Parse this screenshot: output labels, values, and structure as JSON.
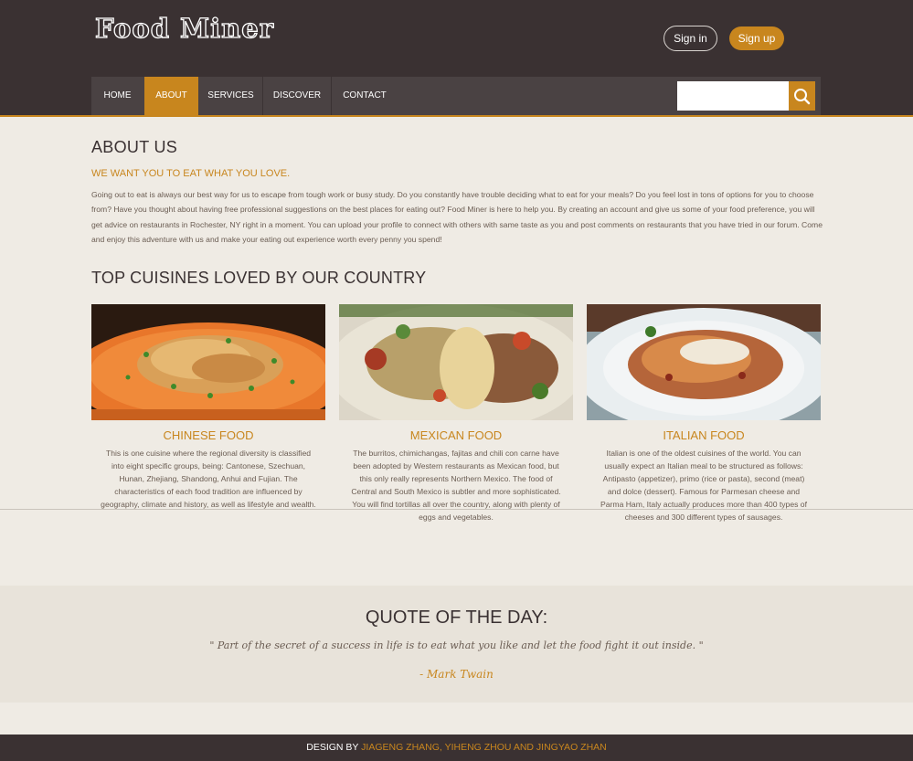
{
  "header": {
    "logo": "Food Miner",
    "signin_label": "Sign in",
    "signup_label": "Sign up"
  },
  "nav": {
    "items": [
      {
        "label": "HOME"
      },
      {
        "label": "ABOUT"
      },
      {
        "label": "SERVICES"
      },
      {
        "label": "DISCOVER"
      },
      {
        "label": "CONTACT"
      }
    ],
    "active": "ABOUT",
    "search_placeholder": ""
  },
  "about": {
    "title": "ABOUT US",
    "subtitle": "WE WANT YOU TO EAT WHAT YOU LOVE.",
    "text": "Going out to eat is always our best way for us to escape from tough work or busy study. Do you constantly have trouble deciding what to eat for your meals? Do you feel lost in tons of options for you to choose from? Have you thought about having free professional suggestions on the best places for eating out? Food Miner is here to help you. By creating an account and give us some of your food preference, you will get advice on restaurants in Rochester, NY right in a moment. You can upload your profile to connect with others with same taste as you and post comments on restaurants that you have tried in our forum. Come and enjoy this adventure with us and make your eating out experience worth every penny you spend!"
  },
  "cuisines": {
    "title": "TOP CUISINES LOVED BY OUR COUNTRY",
    "cards": [
      {
        "title": "CHINESE FOOD",
        "text": "This is one cuisine where the regional diversity is classified into eight specific groups, being: Cantonese, Szechuan, Hunan, Zhejiang, Shandong, Anhui and Fujian. The characteristics of each food tradition are influenced by geography, climate and history, as well as lifestyle and wealth."
      },
      {
        "title": "MEXICAN FOOD",
        "text": "The burritos, chimichangas, fajitas and chili con carne have been adopted by Western restaurants as Mexican food, but this only really represents Northern Mexico. The food of Central and South Mexico is subtler and more sophisticated. You will find tortillas all over the country, along with plenty of eggs and vegetables."
      },
      {
        "title": "ITALIAN FOOD",
        "text": "Italian is one of the oldest cuisines of the world. You can usually expect an Italian meal to be structured as follows: Antipasto (appetizer), primo (rice or pasta), second (meat) and dolce (dessert). Famous for Parmesan cheese and Parma Ham, Italy actually produces more than 400 types of cheeses and 300 different types of sausages."
      }
    ]
  },
  "quote": {
    "title": "QUOTE OF THE DAY:",
    "text": "\" Part of the secret of a success in life is to eat what you like and let the food fight it out inside. \"",
    "author": "- Mark Twain"
  },
  "footer": {
    "prefix": "DESIGN BY ",
    "names": "JIAGENG ZHANG, YIHENG ZHOU AND JINGYAO ZHAN"
  },
  "colors": {
    "accent": "#c8861e",
    "header_bg": "#3a3132",
    "page_bg": "#efebe4"
  }
}
